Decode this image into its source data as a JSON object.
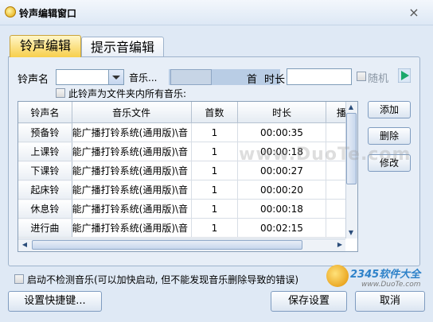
{
  "window": {
    "title": "铃声编辑窗口",
    "close_glyph": "×"
  },
  "tabs": [
    {
      "label": "铃声编辑"
    },
    {
      "label": "提示音编辑"
    }
  ],
  "form": {
    "ring_name_label": "铃声名",
    "ring_name_value": "",
    "music_label": "音乐...",
    "count_unit": "首",
    "duration_label": "时长",
    "duration_value": "",
    "random_label": "随机",
    "folder_checkbox_label": "此铃声为文件夹内所有音乐:"
  },
  "table": {
    "columns": [
      "铃声名",
      "音乐文件",
      "首数",
      "时长",
      "播"
    ],
    "rows": [
      {
        "name": "预备铃",
        "file": "能广播打铃系统(通用版)\\音",
        "count": "1",
        "duration": "00:00:35"
      },
      {
        "name": "上课铃",
        "file": "能广播打铃系统(通用版)\\音",
        "count": "1",
        "duration": "00:00:18"
      },
      {
        "name": "下课铃",
        "file": "能广播打铃系统(通用版)\\音",
        "count": "1",
        "duration": "00:00:27"
      },
      {
        "name": "起床铃",
        "file": "能广播打铃系统(通用版)\\音",
        "count": "1",
        "duration": "00:00:20"
      },
      {
        "name": "休息铃",
        "file": "能广播打铃系统(通用版)\\音",
        "count": "1",
        "duration": "00:00:18"
      },
      {
        "name": "进行曲",
        "file": "能广播打铃系统(通用版)\\音",
        "count": "1",
        "duration": "00:02:15"
      }
    ]
  },
  "side_buttons": {
    "add": "添加",
    "delete": "删除",
    "edit": "修改"
  },
  "startup_checkbox_label": "启动不检测音乐(可以加快启动, 但不能发现音乐删除导致的错误)",
  "bottom_buttons": {
    "hotkey": "设置快捷键...",
    "save": "保存设置",
    "cancel": "取消"
  },
  "watermark": "www.DuoTe.com",
  "logo": {
    "brand": "2345软件大全",
    "url": "www.DuoTe.com"
  },
  "colors": {
    "active_tab": "#f7cf4c",
    "panel": "#e7eef7",
    "play": "#1aa86a"
  }
}
